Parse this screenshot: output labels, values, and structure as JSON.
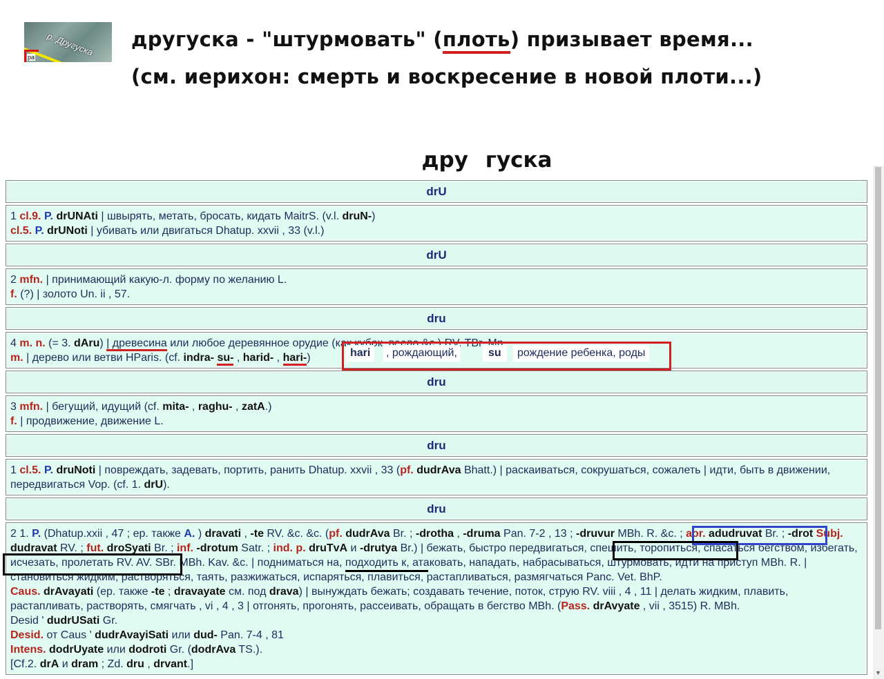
{
  "header": {
    "thumb_label": "р. Другуска",
    "thumb_small": "ра",
    "line1": {
      "part1": "другуска -   \"штурмовать\"  (",
      "underlined": "плоть",
      "part2": ") призывает время..."
    },
    "line2": "(см. иерихон: смерть и воскресение в новой плоти...)",
    "word_title": "дру  гуска"
  },
  "entries": [
    {
      "headword": "drU",
      "lines": [
        [
          "1 ",
          {
            "g": "cl.9."
          },
          " ",
          {
            "b": "P."
          },
          " ",
          {
            "k": "drUNAti"
          },
          " | швырять, метать, бросать, кидать MaitrS. (v.l. ",
          {
            "k": "druN-"
          },
          ")"
        ],
        [
          {
            "g": "cl.5."
          },
          " ",
          {
            "b": "P."
          },
          " ",
          {
            "k": "drUNoti"
          },
          " | убивать или двигаться Dhatup. xxvii , 33 (v.l.)"
        ]
      ]
    },
    {
      "headword": "drU",
      "lines": [
        [
          "2 ",
          {
            "g": "mfn."
          },
          " | принимающий какую-л. форму по желанию L."
        ],
        [
          {
            "g": "f."
          },
          " (?) | золото Un. ii , 57."
        ]
      ]
    },
    {
      "headword": "dru",
      "lines": [
        [
          "4 ",
          {
            "g": "m. n."
          },
          " (= 3. ",
          {
            "k": "dAru"
          },
          ") ",
          {
            "r": "| древесина"
          },
          " или любое деревянное орудие (как кубок, весло &c.) RV. TBr. Mn."
        ],
        [
          {
            "g": "m."
          },
          " | дерево или ветви HParis. (cf. ",
          {
            "k": "indra-"
          },
          " ",
          {
            "kr": "su-"
          },
          " , ",
          {
            "k": "harid-"
          },
          " , ",
          {
            "kr": "hari-"
          },
          ")"
        ]
      ]
    },
    {
      "headword": "dru",
      "lines": [
        [
          "3 ",
          {
            "g": "mfn."
          },
          " | бегущий, идущий (cf. ",
          {
            "k": "mita-"
          },
          " , ",
          {
            "k": "raghu-"
          },
          " , ",
          {
            "k": "zatA"
          },
          ".)"
        ],
        [
          {
            "g": "f."
          },
          " | продвижение, движение L."
        ]
      ]
    },
    {
      "headword": "dru",
      "lines": [
        [
          "1 ",
          {
            "g": "cl.5."
          },
          " ",
          {
            "b": "P."
          },
          " ",
          {
            "k": "druNoti"
          },
          " | повреждать, задевать, портить, ранить Dhatup. xxvii , 33 (",
          {
            "g": "pf."
          },
          " ",
          {
            "k": "dudrAva"
          },
          " Bhatt.) | раскаиваться, сокрушаться, сожалеть | идти, быть в движении, передвигаться Vop. (cf. 1. ",
          {
            "k": "drU"
          },
          ")."
        ]
      ]
    },
    {
      "headword": "dru",
      "lines": [
        [
          "2 1. ",
          {
            "b": "P."
          },
          " (Dhatup.xxii , 47 ; ep. также ",
          {
            "b": "A."
          },
          " ) ",
          {
            "k": "dravati"
          },
          " , ",
          {
            "k": "-te"
          },
          " RV. &c. &c. (",
          {
            "g": "pf."
          },
          " ",
          {
            "k": "dudrAva"
          },
          " Br. ; ",
          {
            "k": "-drotha"
          },
          " , ",
          {
            "k": "-druma"
          },
          " Pan. 7-2 , 13 ; ",
          {
            "k": "-druvur"
          },
          " MBh. R. &c. ; ",
          {
            "g": "aor."
          },
          " ",
          {
            "k": "adudruvat"
          },
          " Br. ; ",
          {
            "k": "-drot"
          },
          " ",
          {
            "g": "Subj."
          },
          " ",
          {
            "k": "dudravat"
          },
          " RV. ; ",
          {
            "g": "fut."
          },
          " ",
          {
            "k": "droSyati"
          },
          " Br. ; ",
          {
            "g": "inf."
          },
          " ",
          {
            "k": "-drotum"
          },
          " Satr. ; ",
          {
            "g": "ind. p."
          },
          " ",
          {
            "k": "druTvA"
          },
          " и ",
          {
            "k": "-drutya"
          },
          " Br.) | бежать, быстро передвигаться, спешить, торопиться, спасаться бегством, избегать, исчезать, пролетать RV. AV. SBr. MBh. Kav. &c. | подниматься на, подходить к, атаковать, нападать, набрасываться, штурмовать, идти на приступ MBh. R. | становиться жидким, растворяться, таять, разжижаться, испаряться, плавиться, растапливаться, размягчаться Panc. Vet. BhP."
        ],
        [
          {
            "g": "Caus."
          },
          " ",
          {
            "k": "drAvayati"
          },
          " (ep. также ",
          {
            "k": "-te"
          },
          " ; ",
          {
            "k": "dravayate"
          },
          " см. под ",
          {
            "k": "drava"
          },
          ") | вынуждать бежать; создавать течение, поток, струю RV. viii , 4 , 11 | делать жидким, плавить, растапливать, растворять, смягчать , vi , 4 , 3 | отгонять, прогонять, рассеивать, обращать в бегство MBh. (",
          {
            "g": "Pass."
          },
          " ",
          {
            "k": "drAvyate"
          },
          " , vii , 3515) R. MBh."
        ],
        [
          "Desid ' ",
          {
            "k": "dudrUSati"
          },
          " Gr."
        ],
        [
          {
            "g": "Desid."
          },
          " от Caus ' ",
          {
            "k": "dudrAvayiSati"
          },
          " или ",
          {
            "k": "dud-"
          },
          " Pan. 7-4 , 81"
        ],
        [
          {
            "g": "Intens."
          },
          " ",
          {
            "k": "dodrUyate"
          },
          " или ",
          {
            "k": "dodroti"
          },
          " Gr. (",
          {
            "k": "dodrAva"
          },
          " TS.)."
        ],
        [
          "[Cf.2. ",
          {
            "k": "drA"
          },
          " и ",
          {
            "k": "dram"
          },
          " ; Zd. ",
          {
            "k": "dru"
          },
          " , ",
          {
            "k": "drvant"
          },
          ".]"
        ]
      ]
    }
  ],
  "annotation": {
    "hari": "hari",
    "hari_gloss": ", рождающий,",
    "su": "su",
    "su_gloss": "рождение ребенка, роды"
  }
}
